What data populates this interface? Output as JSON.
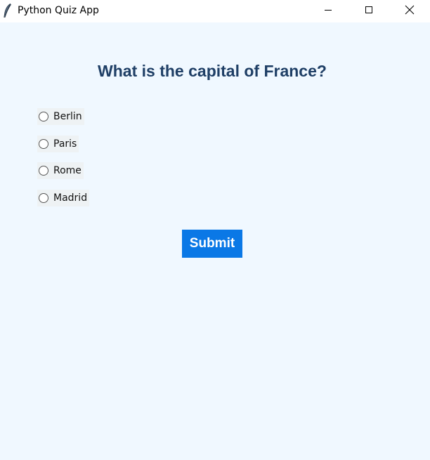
{
  "window": {
    "title": "Python Quiz App",
    "icon": "feather-icon",
    "controls": [
      "minimize-icon",
      "maximize-icon",
      "close-icon"
    ]
  },
  "quiz": {
    "question": "What is the capital of France?",
    "options": [
      {
        "label": "Berlin",
        "selected": false
      },
      {
        "label": "Paris",
        "selected": false
      },
      {
        "label": "Rome",
        "selected": false
      },
      {
        "label": "Madrid",
        "selected": false
      }
    ],
    "submit_label": "Submit"
  },
  "colors": {
    "background": "#f0f8ff",
    "question_text": "#1f3f66",
    "submit_bg": "#0a78e6",
    "submit_text": "#ffffff"
  }
}
